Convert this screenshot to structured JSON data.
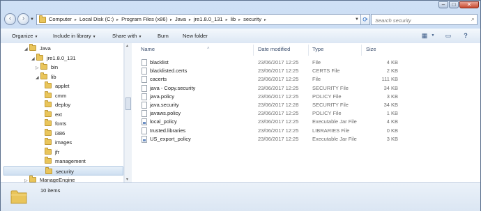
{
  "window": {
    "controls": {
      "minimize": "–",
      "maximize": "□",
      "close": "✕"
    }
  },
  "address": {
    "crumbs": [
      "Computer",
      "Local Disk (C:)",
      "Program Files (x86)",
      "Java",
      "jre1.8.0_131",
      "lib",
      "security"
    ],
    "separator": "▸"
  },
  "search": {
    "placeholder": "Search security"
  },
  "toolbar": {
    "organize": "Organize",
    "include_in_library": "Include in library",
    "share_with": "Share with",
    "burn": "Burn",
    "new_folder": "New folder"
  },
  "nav": {
    "tree": [
      {
        "label": "Java",
        "level": 0,
        "expanded": true
      },
      {
        "label": "jre1.8.0_131",
        "level": 1,
        "expanded": true
      },
      {
        "label": "bin",
        "level": 2,
        "expanded": false
      },
      {
        "label": "lib",
        "level": 2,
        "expanded": true
      },
      {
        "label": "applet",
        "level": 3,
        "expanded": false
      },
      {
        "label": "cmm",
        "level": 3,
        "expanded": false
      },
      {
        "label": "deploy",
        "level": 3,
        "expanded": false
      },
      {
        "label": "ext",
        "level": 3,
        "expanded": false
      },
      {
        "label": "fonts",
        "level": 3,
        "expanded": false
      },
      {
        "label": "i386",
        "level": 3,
        "expanded": false
      },
      {
        "label": "images",
        "level": 3,
        "expanded": false
      },
      {
        "label": "jfr",
        "level": 3,
        "expanded": false
      },
      {
        "label": "management",
        "level": 3,
        "expanded": false
      },
      {
        "label": "security",
        "level": 3,
        "expanded": false,
        "selected": true
      },
      {
        "label": "ManageEngine",
        "level": 0,
        "expanded": false
      }
    ]
  },
  "columns": {
    "name": "Name",
    "date": "Date modified",
    "type": "Type",
    "size": "Size"
  },
  "files": [
    {
      "name": "blacklist",
      "date": "23/06/2017 12:25",
      "type": "File",
      "size": "4 KB",
      "icon": "file-icon"
    },
    {
      "name": "blacklisted.certs",
      "date": "23/06/2017 12:25",
      "type": "CERTS File",
      "size": "2 KB",
      "icon": "file-icon"
    },
    {
      "name": "cacerts",
      "date": "23/06/2017 12:25",
      "type": "File",
      "size": "111 KB",
      "icon": "file-icon"
    },
    {
      "name": "java - Copy.security",
      "date": "23/06/2017 12:25",
      "type": "SECURITY File",
      "size": "34 KB",
      "icon": "file-icon"
    },
    {
      "name": "java.policy",
      "date": "23/06/2017 12:25",
      "type": "POLICY File",
      "size": "3 KB",
      "icon": "file-icon"
    },
    {
      "name": "java.security",
      "date": "23/06/2017 12:28",
      "type": "SECURITY File",
      "size": "34 KB",
      "icon": "file-icon"
    },
    {
      "name": "javaws.policy",
      "date": "23/06/2017 12:25",
      "type": "POLICY File",
      "size": "1 KB",
      "icon": "file-icon"
    },
    {
      "name": "local_policy",
      "date": "23/06/2017 12:25",
      "type": "Executable Jar File",
      "size": "4 KB",
      "icon": "jar-icon"
    },
    {
      "name": "trusted.libraries",
      "date": "23/06/2017 12:25",
      "type": "LIBRARIES File",
      "size": "0 KB",
      "icon": "file-icon"
    },
    {
      "name": "US_export_policy",
      "date": "23/06/2017 12:25",
      "type": "Executable Jar File",
      "size": "3 KB",
      "icon": "jar-icon"
    }
  ],
  "status": {
    "count": "10 items"
  }
}
